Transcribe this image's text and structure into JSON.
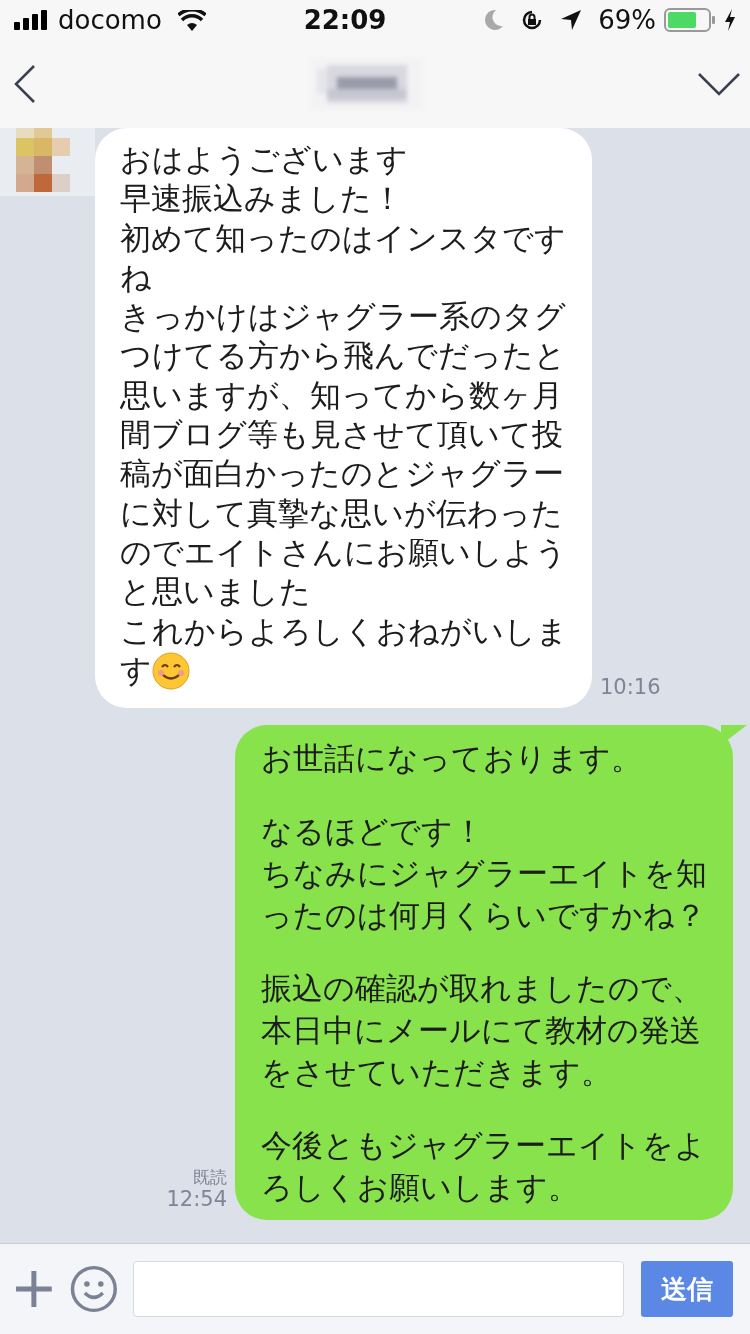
{
  "status_bar": {
    "carrier": "docomo",
    "time": "22:09",
    "battery": "69%"
  },
  "messages": [
    {
      "kind": "incoming",
      "paragraphs": [
        [
          "おはようございます",
          "早速振込みました！",
          "初めて知ったのはインスタです",
          "ね",
          "きっかけはジャグラー系のタグ",
          "つけてる方から飛んでだったと",
          "思いますが、知ってから数ヶ月",
          "間ブログ等も見させて頂いて投",
          "稿が面白かったのとジャグラー",
          "に対して真摯な思いが伝わった",
          "のでエイトさんにお願いしよう",
          "と思いました",
          "これからよろしくおねがいしま",
          "す"
        ]
      ],
      "trailing_emoji": true,
      "time": "10:16"
    },
    {
      "kind": "outgoing",
      "paragraphs": [
        [
          "お世話になっております。"
        ],
        [
          "なるほどです！",
          "ちなみにジャグラーエイトを知",
          "ったのは何月くらいですかね？"
        ],
        [
          "振込の確認が取れましたので、",
          "本日中にメールにて教材の発送",
          "をさせていただきます。"
        ],
        [
          "今後ともジャグラーエイトをよ",
          "ろしくお願いします。"
        ]
      ],
      "trailing_emoji": false,
      "read_label": "既読",
      "time": "12:54"
    }
  ],
  "composer": {
    "send_label": "送信"
  }
}
